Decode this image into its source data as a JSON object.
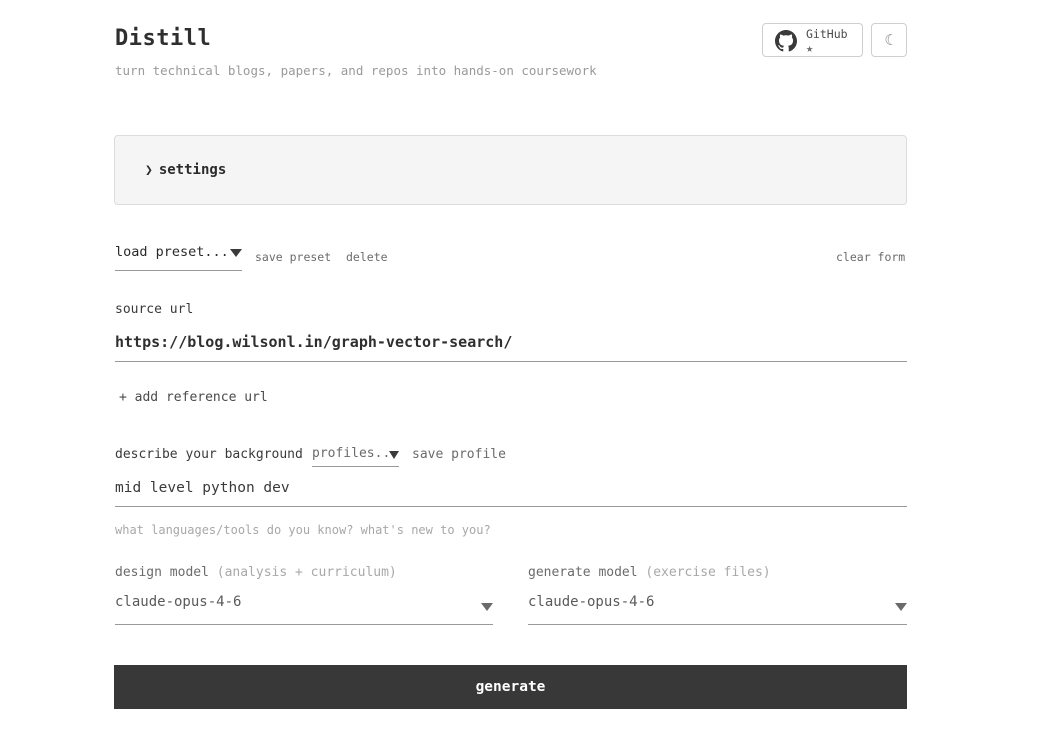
{
  "header": {
    "title": "Distill",
    "subtitle": "turn technical blogs, papers, and repos into hands-on coursework",
    "github_label": "GitHub",
    "github_star": "★",
    "theme_toggle_glyph": "☾"
  },
  "settings": {
    "chevron": "❯",
    "label": "settings"
  },
  "preset_bar": {
    "load_preset": "load preset...",
    "save_preset": "save preset",
    "delete": "delete",
    "clear_form": "clear form"
  },
  "source": {
    "label": "source url",
    "value": "https://blog.wilsonl.in/graph-vector-search/",
    "add_reference": "+ add reference url"
  },
  "background": {
    "label": "describe your background",
    "profiles": "profiles..",
    "save_profile": "save profile",
    "value": "mid level python dev",
    "hint": "what languages/tools do you know? what's new to you?"
  },
  "models": {
    "design_label": "design model",
    "design_hint": "(analysis + curriculum)",
    "design_value": "claude-opus-4-6",
    "generate_label": "generate model",
    "generate_hint": "(exercise files)",
    "generate_value": "claude-opus-4-6"
  },
  "actions": {
    "generate": "generate"
  },
  "icons": {
    "github": "github-icon",
    "theme": "moon-icon",
    "chevron": "chevron-right-icon",
    "dropdown": "caret-down-icon"
  }
}
